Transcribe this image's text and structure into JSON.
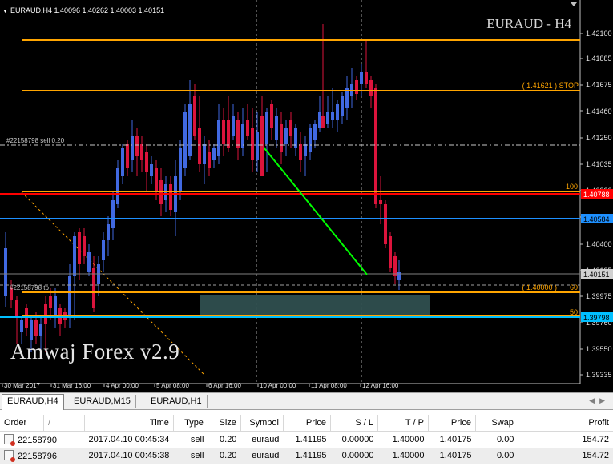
{
  "chart": {
    "header": "EURAUD,H4  1.40096 1.40262 1.40003 1.40151",
    "watermark": "EURAUD - H4",
    "brand": "Amwaj Forex v2.9",
    "order_label": "#22158798 sell 0.20",
    "tp_label": "#22158798 tp",
    "stop_label": "( 1.41621 )  STOP",
    "target_label": "( 1.40000 )",
    "level_100": "100",
    "level_60": "60",
    "level_50": "50",
    "price_ticks": [
      "1.42100",
      "1.41885",
      "1.41675",
      "1.41460",
      "1.41250",
      "1.41035",
      "1.40820",
      "1.40610",
      "1.40400",
      "1.40185",
      "1.39975",
      "1.39760",
      "1.39550",
      "1.39335"
    ],
    "price_tags": {
      "red": "1.40788",
      "blue": "1.40584",
      "current": "1.40151",
      "cyan": "1.39798"
    },
    "time_ticks": [
      "30 Mar 2017",
      "31 Mar 16:00",
      "4 Apr 00:00",
      "5 Apr 08:00",
      "6 Apr 16:00",
      "10 Apr 00:00",
      "11 Apr 08:00",
      "12 Apr 16:00"
    ],
    "colors": {
      "up": "#4169e1",
      "down": "#dc143c",
      "orange": "#ffa500",
      "red": "#ff0000",
      "blue": "#1e90ff",
      "green": "#00ff00"
    }
  },
  "tabs": [
    "EURAUD,H4",
    "EURAUD,M15",
    "EURAUD,H1"
  ],
  "terminal": {
    "columns": [
      "Order",
      "/",
      "Time",
      "Type",
      "Size",
      "Symbol",
      "Price",
      "S / L",
      "T / P",
      "Price",
      "Swap",
      "Profit"
    ],
    "rows": [
      {
        "order": "22158790",
        "time": "2017.04.10 00:45:34",
        "type": "sell",
        "size": "0.20",
        "symbol": "euraud",
        "price": "1.41195",
        "sl": "0.00000",
        "tp": "1.40000",
        "cur": "1.40175",
        "swap": "0.00",
        "profit": "154.72"
      },
      {
        "order": "22158796",
        "time": "2017.04.10 00:45:38",
        "type": "sell",
        "size": "0.20",
        "symbol": "euraud",
        "price": "1.41195",
        "sl": "0.00000",
        "tp": "1.40000",
        "cur": "1.40175",
        "swap": "0.00",
        "profit": "154.72"
      }
    ]
  }
}
